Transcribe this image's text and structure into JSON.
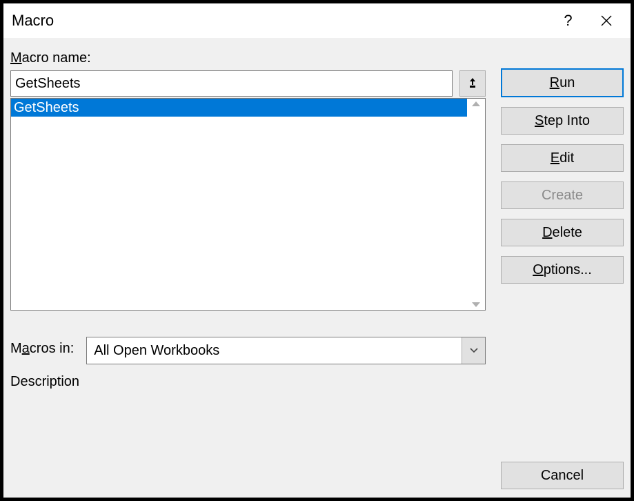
{
  "title": "Macro",
  "macro_name_label": "Macro name:",
  "macro_name_value": "GetSheets",
  "macro_list": [
    "GetSheets"
  ],
  "macros_in_label": "Macros in:",
  "macros_in_value": "All Open Workbooks",
  "description_label": "Description",
  "buttons": {
    "run": "Run",
    "step_into": "Step Into",
    "edit": "Edit",
    "create": "Create",
    "delete": "Delete",
    "options": "Options...",
    "cancel": "Cancel"
  },
  "underline": {
    "macro_name": "M",
    "run": "R",
    "step_into": "S",
    "edit": "E",
    "delete": "D",
    "options": "O",
    "macros_in": "a"
  }
}
